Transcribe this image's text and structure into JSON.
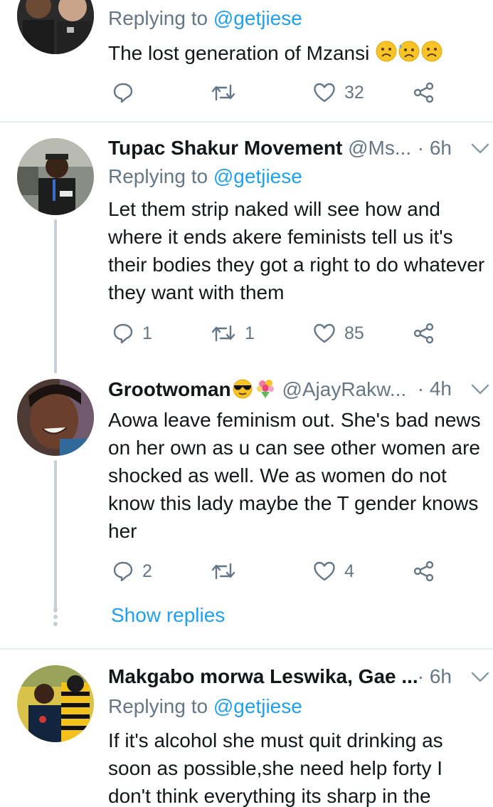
{
  "tweets": [
    {
      "replying_prefix": "Replying to",
      "replying_to": "@getjiese",
      "text": "The lost generation of Mzansi",
      "emoji_names": [
        "sad-face-icon",
        "sad-sweat-face-icon",
        "sad-face-icon"
      ],
      "replies": "",
      "retweets": "",
      "likes": "32"
    },
    {
      "name": "Tupac Shakur Movement",
      "handle": "@Ms...",
      "time": "· 6h",
      "replying_prefix": "Replying to",
      "replying_to": "@getjiese",
      "text": "Let them strip naked will see how and where it ends akere feminists tell us it's their bodies they got a right to do whatever they want with them",
      "replies": "1",
      "retweets": "1",
      "likes": "85"
    },
    {
      "name": "Grootwoman",
      "name_emoji": [
        "sunglasses-face-icon",
        "bouquet-icon"
      ],
      "handle": "@AjayRakw...",
      "time": "· 4h",
      "text": "Aowa leave feminism out. She's bad news on her own as u can see other women are shocked as well. We as women do not know this lady maybe the T gender knows her",
      "replies": "2",
      "retweets": "",
      "likes": "4"
    },
    {
      "name": "Makgabo morwa Leswika, Gae ...",
      "time": "· 6h",
      "replying_prefix": "Replying to",
      "replying_to": "@getjiese",
      "text": "If it's alcohol she must quit drinking  as soon as  possible,she need help forty I don't think  everything its sharp in the"
    }
  ],
  "show_replies": "Show replies",
  "colors": {
    "link": "#1da1f2",
    "muted": "#657786",
    "text": "#14171a",
    "divider": "#e6ecf0",
    "thread": "#c4cfd6"
  }
}
